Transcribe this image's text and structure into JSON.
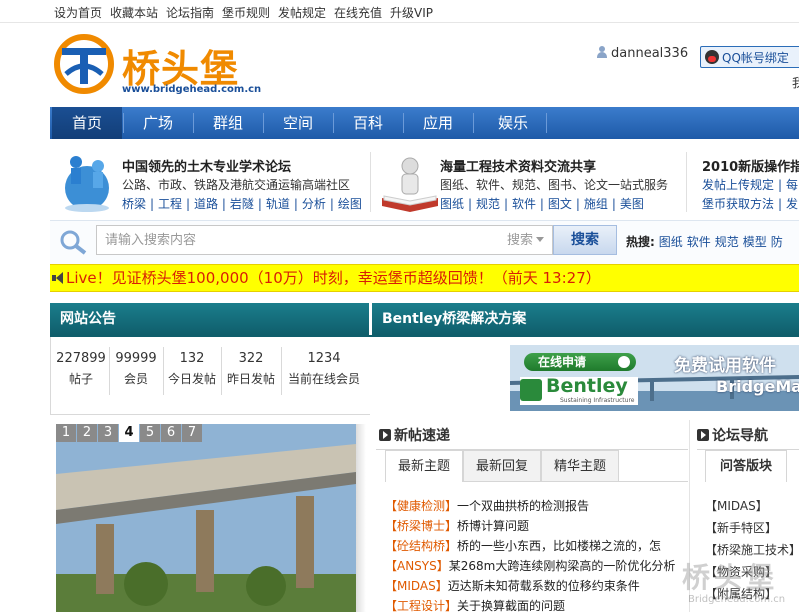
{
  "toplinks": [
    "设为首页",
    "收藏本站",
    "论坛指南",
    "堡币规则",
    "发帖规定",
    "在线充值",
    "升级VIP"
  ],
  "logo": {
    "brand": "桥头堡",
    "url": "www.bridgehead.com.cn"
  },
  "user": {
    "name": "danneal336",
    "qq_button": "QQ帐号绑定",
    "extra": "我"
  },
  "nav": [
    "首页",
    "广场",
    "群组",
    "空间",
    "百科",
    "应用",
    "娱乐"
  ],
  "promo": [
    {
      "title": "中国领先的土木专业学术论坛",
      "line1": "公路、市政、铁路及港航交通运输高端社区",
      "links": [
        "桥梁",
        "工程",
        "道路",
        "岩隧",
        "轨道",
        "分析",
        "绘图"
      ]
    },
    {
      "title": "海量工程技术资料交流共享",
      "line1": "图纸、软件、规范、图书、论文一站式服务",
      "links": [
        "图纸",
        "规范",
        "软件",
        "图文",
        "施组",
        "美图"
      ]
    },
    {
      "title": "2010新版操作指",
      "links_a": [
        "发帖上传规定",
        "每"
      ],
      "links_b": [
        "堡币获取方法",
        "发"
      ]
    }
  ],
  "search": {
    "placeholder": "请输入搜索内容",
    "select": "搜索",
    "button": "搜索",
    "hot_label": "热搜:",
    "hot": [
      "图纸",
      "软件",
      "规范",
      "模型",
      "防"
    ]
  },
  "live": "Live！见证桥头堡100,000（10万）时刻，幸运堡币超级回馈！（前天 13:27）",
  "sections": {
    "notice": "网站公告",
    "bentley": "Bentley桥梁解决方案"
  },
  "stats": [
    {
      "value": "227899",
      "label": "帖子"
    },
    {
      "value": "99999",
      "label": "会员"
    },
    {
      "value": "132",
      "label": "今日发帖"
    },
    {
      "value": "322",
      "label": "昨日发帖"
    },
    {
      "value": "1234",
      "label": "当前在线会员"
    }
  ],
  "bentley_ad": {
    "apply": "在线申请",
    "free": "免费试用软件",
    "product": "BridgeMa",
    "brand": "Bentley",
    "tagline": "Sustaining Infrastructure"
  },
  "slides": [
    "1",
    "2",
    "3",
    "4",
    "5",
    "6",
    "7"
  ],
  "new_posts": {
    "title": "新帖速递",
    "tabs": [
      "最新主题",
      "最新回复",
      "精华主题"
    ],
    "items": [
      {
        "cat": "【健康检测】",
        "text": "一个双曲拱桥的检测报告"
      },
      {
        "cat": "【桥梁博士】",
        "text": "桥博计算问题"
      },
      {
        "cat": "【砼结构桥】",
        "text": "桥的一些小东西，比如楼梯之流的，怎"
      },
      {
        "cat": "【ANSYS】",
        "text": "某268m大跨连续刚构梁高的一阶优化分析"
      },
      {
        "cat": "【MIDAS】",
        "text": "迈达斯未知荷载系数的位移约束条件"
      },
      {
        "cat": "【工程设计】",
        "text": "关于换算截面的问题"
      }
    ]
  },
  "forum_nav": {
    "title": "论坛导航",
    "tab": "问答版块",
    "items": [
      "【MIDAS】",
      "【新手特区】",
      "【桥梁施工技术】",
      "【物资采购】",
      "【附属结构】"
    ]
  },
  "watermark": {
    "cn": "桥头堡",
    "en": "Bridgehead.com.cn"
  }
}
